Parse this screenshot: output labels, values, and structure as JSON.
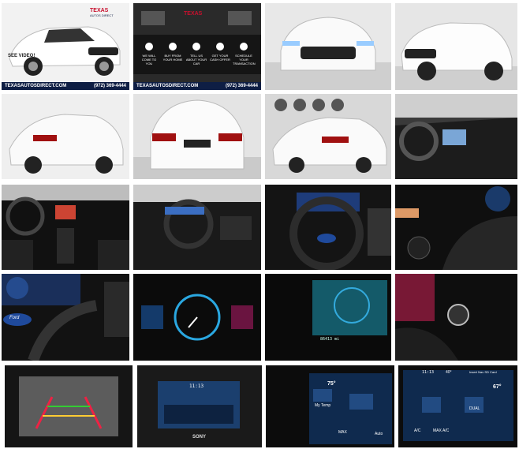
{
  "gallery": {
    "see_video": "SEE VIDEO!",
    "dealer_url": "TEXASAUTOSDIRECT.COM",
    "dealer_phone": "(972) 369-4444",
    "dealer_phone_2": "(972) 369-4444",
    "dealer_url_2": "TEXASAUTOSDIRECT.COM",
    "logo_text": "TEXAS",
    "logo_sub": "AUTOS DIRECT",
    "promo": [
      "WE WILL COME TO YOU",
      "BUY FROM YOUR HOME",
      "TELL US ABOUT YOUR CAR",
      "GET YOUR CASH OFFER",
      "SCHEDULE YOUR TRANSACTION"
    ],
    "odometer": "86413 mi",
    "temp_left": "75°",
    "temp_right": "67°",
    "climate_my_temp": "My Temp",
    "climate_max": "MAX",
    "climate_auto": "Auto",
    "climate_ac": "A/C",
    "climate_max_ac": "MAX A/C",
    "climate_dual": "DUAL",
    "clock_1": "11:13",
    "clock_2": "11:13",
    "outside_temp": "40°",
    "sd_card": "Insert Nav SD Card",
    "ford_badge": "Ford",
    "sony": "SONY"
  }
}
